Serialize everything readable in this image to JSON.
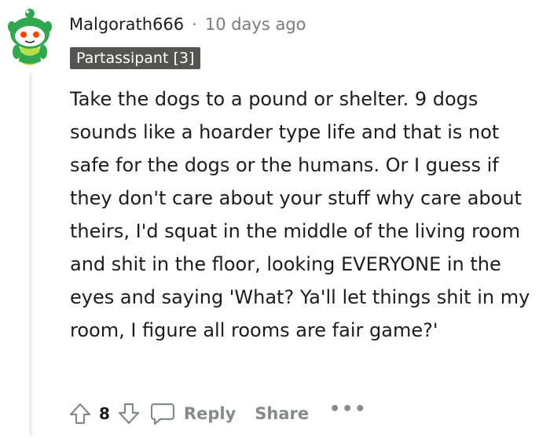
{
  "comment": {
    "author": "Malgorath666",
    "separator": "·",
    "timestamp": "10 days ago",
    "flair": "Partassipant [3]",
    "body": "Take the dogs to a pound or shelter. 9 dogs sounds like a hoarder type life and that is not safe for the dogs or the humans. Or I guess if they don't care about your stuff why care about theirs, I'd squat in the middle of the living room and shit in the floor, looking EVERYONE in the eyes and saying 'What? Ya'll let things shit in my room, I figure all rooms are fair game?'",
    "score": "8"
  },
  "actions": {
    "upvote_icon": "upvote-arrow-icon",
    "downvote_icon": "downvote-arrow-icon",
    "reply_icon": "speech-bubble-icon",
    "reply_label": "Reply",
    "share_label": "Share",
    "more_label": "•••"
  },
  "colors": {
    "avatar_green": "#2fa84f",
    "flair_bg": "#545452",
    "muted_text": "#878a8c",
    "thread_line": "#edeff1"
  }
}
